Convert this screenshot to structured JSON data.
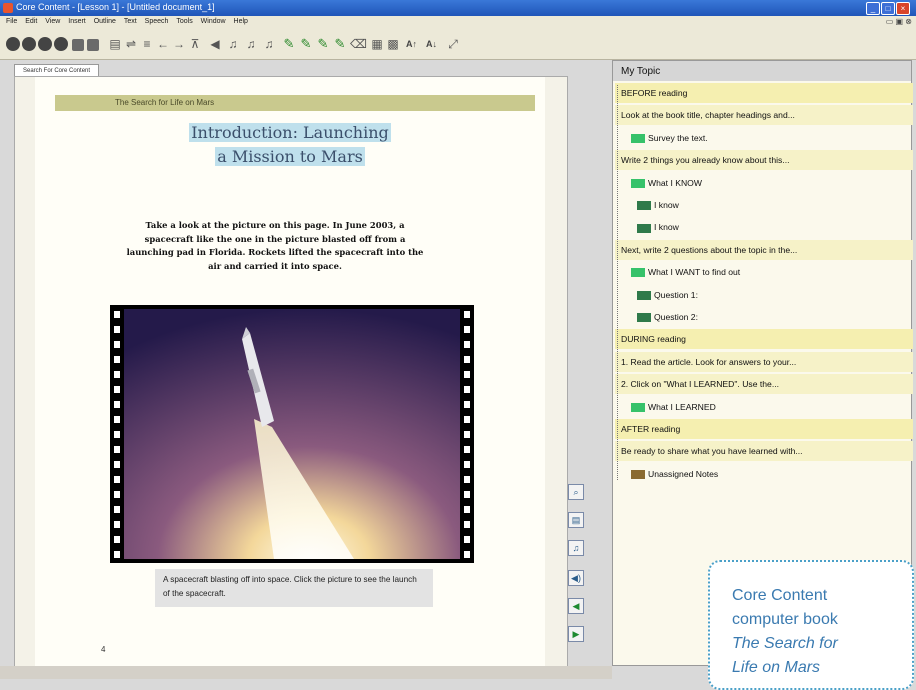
{
  "window": {
    "title": "Core Content - [Lesson 1] - [Untitled document_1]"
  },
  "menu": [
    "File",
    "Edit",
    "View",
    "Insert",
    "Outline",
    "Text",
    "Speech",
    "Tools",
    "Window",
    "Help"
  ],
  "document_tab": "Search For Core Content",
  "page": {
    "header": "The Search for Life on Mars",
    "title_line1": "Introduction: Launching",
    "title_line2": "a Mission to Mars",
    "body": "Take a look at the picture on this page. In June 2003, a spacecraft like the one in the picture blasted off from a launching pad in Florida. Rockets lifted the spacecraft into the air and carried it into space.",
    "caption": "A spacecraft blasting off into space. Click the picture to see the launch of the spacecraft.",
    "page_number": "4"
  },
  "topic": {
    "header": "My Topic",
    "rows": [
      {
        "text": "BEFORE reading",
        "style": "section",
        "indent": 0,
        "marker": ""
      },
      {
        "text": "Look at the book title, chapter headings and...",
        "style": "hl",
        "indent": 0,
        "marker": ""
      },
      {
        "text": "Survey the text.",
        "style": "",
        "indent": 1,
        "marker": "green"
      },
      {
        "text": "Write 2 things you already know about this...",
        "style": "hl",
        "indent": 0,
        "marker": ""
      },
      {
        "text": "What I KNOW",
        "style": "",
        "indent": 1,
        "marker": "green"
      },
      {
        "text": "I know",
        "style": "",
        "indent": 2,
        "marker": "dgreen"
      },
      {
        "text": "I know",
        "style": "",
        "indent": 2,
        "marker": "dgreen"
      },
      {
        "text": "Next, write 2 questions about the topic in the...",
        "style": "hl",
        "indent": 0,
        "marker": ""
      },
      {
        "text": "What I WANT to find out",
        "style": "",
        "indent": 1,
        "marker": "green"
      },
      {
        "text": "Question 1:",
        "style": "",
        "indent": 2,
        "marker": "dgreen"
      },
      {
        "text": "Question 2:",
        "style": "",
        "indent": 2,
        "marker": "dgreen"
      },
      {
        "text": "DURING reading",
        "style": "section",
        "indent": 0,
        "marker": ""
      },
      {
        "text": "1. Read the article. Look for answers to your...",
        "style": "hl",
        "indent": 0,
        "marker": ""
      },
      {
        "text": "2. Click on \"What I LEARNED\". Use the...",
        "style": "hl",
        "indent": 0,
        "marker": ""
      },
      {
        "text": "What I LEARNED",
        "style": "",
        "indent": 1,
        "marker": "green"
      },
      {
        "text": "AFTER reading",
        "style": "section",
        "indent": 0,
        "marker": ""
      },
      {
        "text": "Be ready to share what you have learned with...",
        "style": "hl",
        "indent": 0,
        "marker": ""
      },
      {
        "text": "Unassigned Notes",
        "style": "",
        "indent": 1,
        "marker": "brown"
      }
    ]
  },
  "callout": {
    "line1": "Core Content",
    "line2": "computer book",
    "line3": "The Search for",
    "line4": "Life on Mars"
  },
  "colors": {
    "marker_green": "#36c26a",
    "marker_dark_green": "#2f7a4a",
    "marker_brown": "#8a6a30",
    "section_bg": "#f5efb0",
    "callout_border": "#4aa0c8"
  }
}
